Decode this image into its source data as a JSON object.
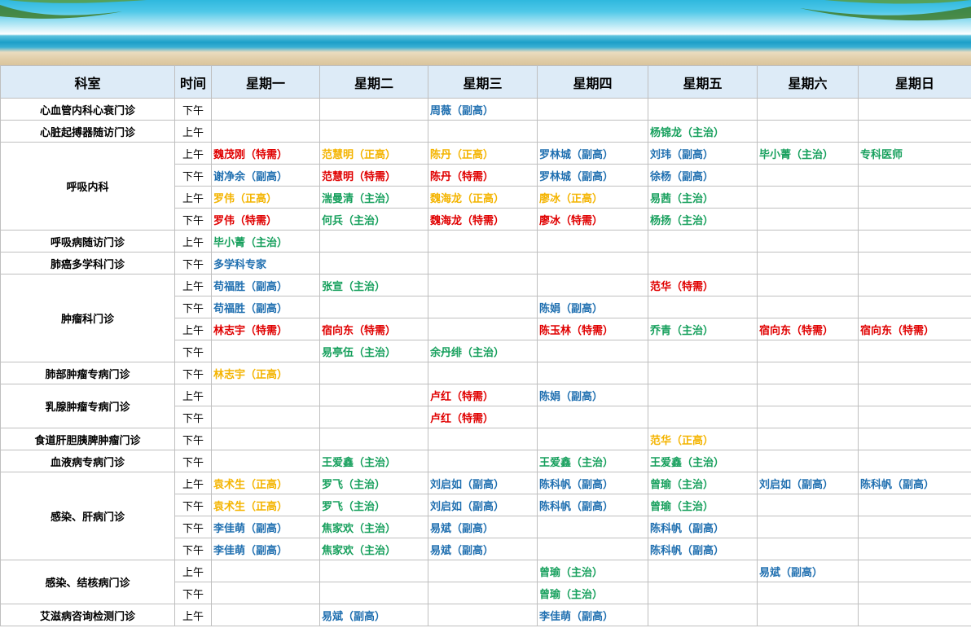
{
  "colors": {
    "red": "#e00000",
    "orange": "#f4b400",
    "green": "#17a05d",
    "blue": "#1f6fb0",
    "header_bg": "#ddebf7"
  },
  "headers": [
    "科室",
    "时间",
    "星期一",
    "星期二",
    "星期三",
    "星期四",
    "星期五",
    "星期六",
    "星期日"
  ],
  "departments": [
    {
      "name": "心血管内科心衰门诊",
      "slots": [
        {
          "time": "下午",
          "cells": [
            null,
            null,
            {
              "t": "周薇（副高）",
              "c": "blue"
            },
            null,
            null,
            null,
            null
          ]
        }
      ]
    },
    {
      "name": "心脏起搏器随访门诊",
      "slots": [
        {
          "time": "上午",
          "cells": [
            null,
            null,
            null,
            null,
            {
              "t": "杨锦龙（主治）",
              "c": "green"
            },
            null,
            null
          ]
        }
      ]
    },
    {
      "name": "呼吸内科",
      "slots": [
        {
          "time": "上午",
          "cells": [
            {
              "t": "魏茂刚（特需）",
              "c": "red"
            },
            {
              "t": "范慧明（正高）",
              "c": "orange"
            },
            {
              "t": "陈丹（正高）",
              "c": "orange"
            },
            {
              "t": "罗林城（副高）",
              "c": "blue"
            },
            {
              "t": "刘玮（副高）",
              "c": "blue"
            },
            {
              "t": "毕小菁（主治）",
              "c": "green"
            },
            {
              "t": "专科医师",
              "c": "green"
            }
          ]
        },
        {
          "time": "下午",
          "cells": [
            {
              "t": "谢净余（副高）",
              "c": "blue"
            },
            {
              "t": "范慧明（特需）",
              "c": "red"
            },
            {
              "t": "陈丹（特需）",
              "c": "red"
            },
            {
              "t": "罗林城（副高）",
              "c": "blue"
            },
            {
              "t": "徐杨（副高）",
              "c": "blue"
            },
            null,
            null
          ]
        },
        {
          "time": "上午",
          "cells": [
            {
              "t": "罗伟（正高）",
              "c": "orange"
            },
            {
              "t": "湍曼清（主治）",
              "c": "green"
            },
            {
              "t": "魏海龙（正高）",
              "c": "orange"
            },
            {
              "t": "廖冰（正高）",
              "c": "orange"
            },
            {
              "t": "易茜（主治）",
              "c": "green"
            },
            null,
            null
          ]
        },
        {
          "time": "下午",
          "cells": [
            {
              "t": "罗伟（特需）",
              "c": "red"
            },
            {
              "t": "何兵（主治）",
              "c": "green"
            },
            {
              "t": "魏海龙（特需）",
              "c": "red"
            },
            {
              "t": "廖冰（特需）",
              "c": "red"
            },
            {
              "t": "杨扬（主治）",
              "c": "green"
            },
            null,
            null
          ]
        }
      ]
    },
    {
      "name": "呼吸病随访门诊",
      "slots": [
        {
          "time": "上午",
          "cells": [
            {
              "t": "毕小菁（主治）",
              "c": "green"
            },
            null,
            null,
            null,
            null,
            null,
            null
          ]
        }
      ]
    },
    {
      "name": "肺癌多学科门诊",
      "slots": [
        {
          "time": "下午",
          "cells": [
            {
              "t": "多学科专家",
              "c": "blue"
            },
            null,
            null,
            null,
            null,
            null,
            null
          ]
        }
      ]
    },
    {
      "name": "肿瘤科门诊",
      "slots": [
        {
          "time": "上午",
          "cells": [
            {
              "t": "苟福胜（副高）",
              "c": "blue"
            },
            {
              "t": "张宣（主治）",
              "c": "green"
            },
            null,
            null,
            {
              "t": "范华（特需）",
              "c": "red"
            },
            null,
            null
          ]
        },
        {
          "time": "下午",
          "cells": [
            {
              "t": "苟福胜（副高）",
              "c": "blue"
            },
            null,
            null,
            {
              "t": "陈娟（副高）",
              "c": "blue"
            },
            null,
            null,
            null
          ]
        },
        {
          "time": "上午",
          "cells": [
            {
              "t": "林志宇（特需）",
              "c": "red"
            },
            {
              "t": "宿向东（特需）",
              "c": "red"
            },
            null,
            {
              "t": "陈玉林（特需）",
              "c": "red"
            },
            {
              "t": "乔青（主治）",
              "c": "green"
            },
            {
              "t": "宿向东（特需）",
              "c": "red"
            },
            {
              "t": "宿向东（特需）",
              "c": "red"
            }
          ]
        },
        {
          "time": "下午",
          "cells": [
            null,
            {
              "t": "易亭伍（主治）",
              "c": "green"
            },
            {
              "t": "余丹绯（主治）",
              "c": "green"
            },
            null,
            null,
            null,
            null
          ]
        }
      ]
    },
    {
      "name": "肺部肿瘤专病门诊",
      "slots": [
        {
          "time": "下午",
          "cells": [
            {
              "t": "林志宇（正高）",
              "c": "orange"
            },
            null,
            null,
            null,
            null,
            null,
            null
          ]
        }
      ]
    },
    {
      "name": "乳腺肿瘤专病门诊",
      "slots": [
        {
          "time": "上午",
          "cells": [
            null,
            null,
            {
              "t": "卢红（特需）",
              "c": "red"
            },
            {
              "t": "陈娟（副高）",
              "c": "blue"
            },
            null,
            null,
            null
          ]
        },
        {
          "time": "下午",
          "cells": [
            null,
            null,
            {
              "t": "卢红（特需）",
              "c": "red"
            },
            null,
            null,
            null,
            null
          ]
        }
      ]
    },
    {
      "name": "食道肝胆胰脾肿瘤门诊",
      "slots": [
        {
          "time": "下午",
          "cells": [
            null,
            null,
            null,
            null,
            {
              "t": "范华（正高）",
              "c": "orange"
            },
            null,
            null
          ]
        }
      ]
    },
    {
      "name": "血液病专病门诊",
      "slots": [
        {
          "time": "下午",
          "cells": [
            null,
            {
              "t": "王爱鑫（主治）",
              "c": "green"
            },
            null,
            {
              "t": "王爱鑫（主治）",
              "c": "green"
            },
            {
              "t": "王爱鑫（主治）",
              "c": "green"
            },
            null,
            null
          ]
        }
      ]
    },
    {
      "name": "感染、肝病门诊",
      "slots": [
        {
          "time": "上午",
          "cells": [
            {
              "t": "袁术生（正高）",
              "c": "orange"
            },
            {
              "t": "罗飞（主治）",
              "c": "green"
            },
            {
              "t": "刘启如（副高）",
              "c": "blue"
            },
            {
              "t": "陈科帆（副高）",
              "c": "blue"
            },
            {
              "t": "曾瑜（主治）",
              "c": "green"
            },
            {
              "t": "刘启如（副高）",
              "c": "blue"
            },
            {
              "t": "陈科帆（副高）",
              "c": "blue"
            }
          ]
        },
        {
          "time": "下午",
          "cells": [
            {
              "t": "袁术生（正高）",
              "c": "orange"
            },
            {
              "t": "罗飞（主治）",
              "c": "green"
            },
            {
              "t": "刘启如（副高）",
              "c": "blue"
            },
            {
              "t": "陈科帆（副高）",
              "c": "blue"
            },
            {
              "t": "曾瑜（主治）",
              "c": "green"
            },
            null,
            null
          ]
        },
        {
          "time": "下午",
          "cells": [
            {
              "t": "李佳萌（副高）",
              "c": "blue"
            },
            {
              "t": "焦家欢（主治）",
              "c": "green"
            },
            {
              "t": "易斌（副高）",
              "c": "blue"
            },
            null,
            {
              "t": "陈科帆（副高）",
              "c": "blue"
            },
            null,
            null
          ]
        },
        {
          "time": "下午",
          "cells": [
            {
              "t": "李佳萌（副高）",
              "c": "blue"
            },
            {
              "t": "焦家欢（主治）",
              "c": "green"
            },
            {
              "t": "易斌（副高）",
              "c": "blue"
            },
            null,
            {
              "t": "陈科帆（副高）",
              "c": "blue"
            },
            null,
            null
          ]
        }
      ]
    },
    {
      "name": "感染、结核病门诊",
      "slots": [
        {
          "time": "上午",
          "cells": [
            null,
            null,
            null,
            {
              "t": "曾瑜（主治）",
              "c": "green"
            },
            null,
            {
              "t": "易斌（副高）",
              "c": "blue"
            },
            null
          ]
        },
        {
          "time": "下午",
          "cells": [
            null,
            null,
            null,
            {
              "t": "曾瑜（主治）",
              "c": "green"
            },
            null,
            null,
            null
          ]
        }
      ]
    },
    {
      "name": "艾滋病咨询检测门诊",
      "slots": [
        {
          "time": "上午",
          "cells": [
            null,
            {
              "t": "易斌（副高）",
              "c": "blue"
            },
            null,
            {
              "t": "李佳萌（副高）",
              "c": "blue"
            },
            null,
            null,
            null
          ]
        }
      ]
    }
  ]
}
